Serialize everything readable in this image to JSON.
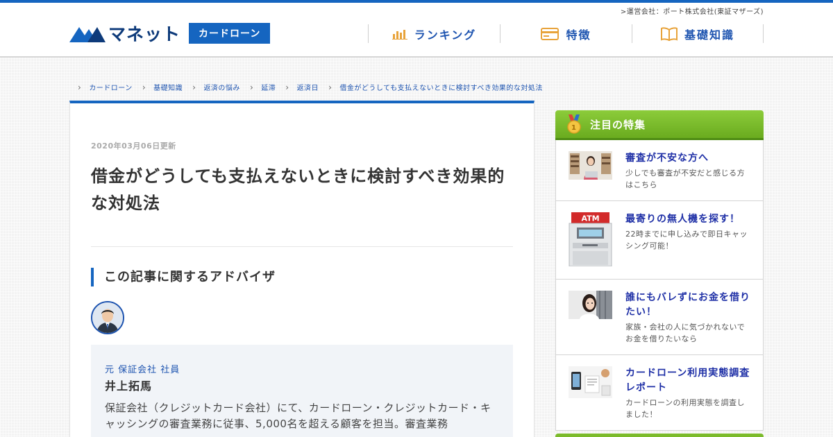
{
  "header": {
    "operator": ">運営会社：ポート株式会社(東証マザーズ)",
    "logo_text": "マネット",
    "logo_badge": "カードローン",
    "nav": [
      {
        "label": "ランキング",
        "icon": "bar-chart-icon"
      },
      {
        "label": "特徴",
        "icon": "card-icon"
      },
      {
        "label": "基礎知識",
        "icon": "book-icon"
      }
    ]
  },
  "breadcrumb": [
    "カードローン",
    "基礎知識",
    "返済の悩み",
    "延滞",
    "返済日",
    "借金がどうしても支払えないときに検討すべき効果的な対処法"
  ],
  "article": {
    "date": "2020年03月06日更新",
    "title": "借金がどうしても支払えないときに検討すべき効果的な対処法",
    "advisor_heading": "この記事に関するアドバイザ",
    "advisor": {
      "role": "元 保証会社 社員",
      "name": "井上拓馬",
      "description": "保証会社（クレジットカード会社）にて、カードローン・クレジットカード・キャッシングの審査業務に従事、5,000名を超える顧客を担当。審査業務"
    }
  },
  "sidebar": {
    "heading": "注目の特集",
    "items": [
      {
        "title": "審査が不安な方へ",
        "desc": "少しでも審査が不安だと感じる方はこちら",
        "thumb": "woman-laptop-photo"
      },
      {
        "title": "最寄りの無人機を探す！",
        "desc": "22時までに申し込みで即日キャッシング可能！",
        "thumb": "atm-illustration"
      },
      {
        "title": "誰にもバレずにお金を借りたい！",
        "desc": "家族・会社の人に気づかれないでお金を借りたいなら",
        "thumb": "woman-peeking-photo"
      },
      {
        "title": "カードローン利用実態調査レポート",
        "desc": "カードローンの利用実態を調査しました！",
        "thumb": "desk-phone-photo"
      }
    ],
    "atm_label": "ATM"
  },
  "colors": {
    "brand_blue": "#1565c0",
    "link_blue": "#1e54b0",
    "sidebar_green": "#7cbb2c"
  }
}
